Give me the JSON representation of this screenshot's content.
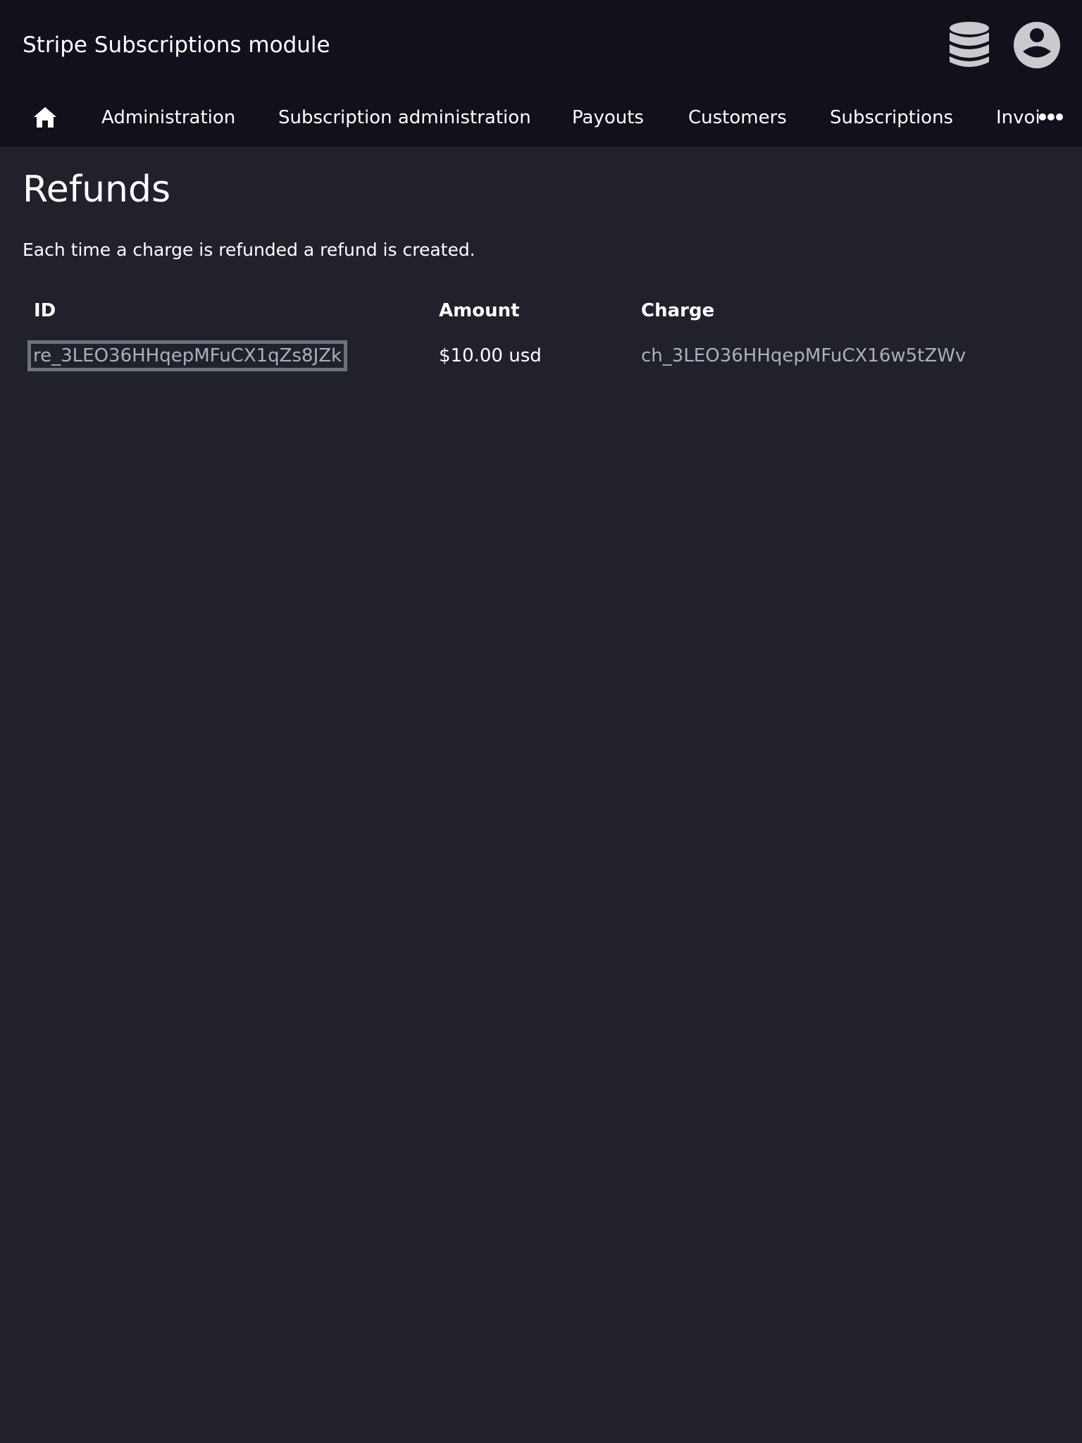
{
  "header": {
    "app_title": "Stripe Subscriptions module",
    "icons": [
      "database-icon",
      "user-account-icon"
    ]
  },
  "nav": {
    "home_icon": "home-icon",
    "items": [
      {
        "label": "Administration"
      },
      {
        "label": "Subscription administration"
      },
      {
        "label": "Payouts"
      },
      {
        "label": "Customers"
      },
      {
        "label": "Subscriptions"
      },
      {
        "label": "Invoices"
      }
    ],
    "more_icon": "more-horizontal-icon"
  },
  "page": {
    "title": "Refunds",
    "description": "Each time a charge is refunded a refund is created."
  },
  "table": {
    "columns": [
      "ID",
      "Amount",
      "Charge"
    ],
    "rows": [
      {
        "id": "re_3LEO36HHqepMFuCX1qZs8JZk",
        "amount": "$10.00 usd",
        "charge": "ch_3LEO36HHqepMFuCX16w5tZWv"
      }
    ]
  },
  "colors": {
    "background": "#20212b",
    "header_background": "#10111b",
    "link_text": "#a9b0bd",
    "focus_outline": "#6c737d",
    "icon_fill": "#c9cace"
  }
}
